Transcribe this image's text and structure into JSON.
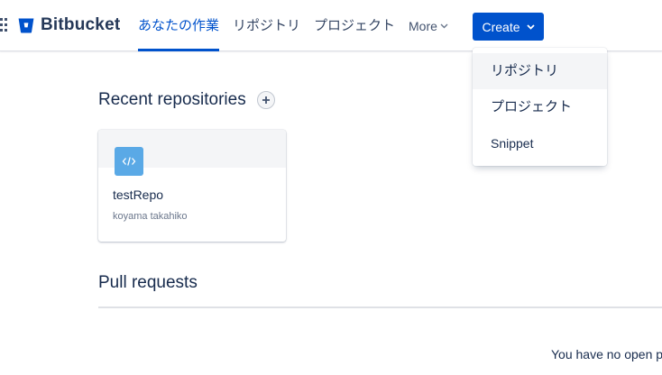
{
  "header": {
    "brand": "Bitbucket",
    "nav": [
      {
        "label": "あなたの作業",
        "active": true
      },
      {
        "label": "リポジトリ",
        "active": false
      },
      {
        "label": "プロジェクト",
        "active": false
      }
    ],
    "more_label": "More",
    "create_label": "Create"
  },
  "create_menu": {
    "items": [
      {
        "label": "リポジトリ",
        "hovered": true
      },
      {
        "label": "プロジェクト",
        "hovered": false
      },
      {
        "label": "Snippet",
        "hovered": false
      }
    ]
  },
  "recent_repositories": {
    "title": "Recent repositories",
    "add_icon": "plus-icon",
    "repos": [
      {
        "name": "testRepo",
        "owner": "koyama takahiko",
        "icon": "code-icon"
      }
    ]
  },
  "pull_requests": {
    "title": "Pull requests",
    "empty_text": "You have no open p"
  },
  "colors": {
    "primary": "#0052cc",
    "text": "#172b4d",
    "repo_avatar": "#5aa9e6",
    "hover_bg": "#f4f5f7"
  }
}
